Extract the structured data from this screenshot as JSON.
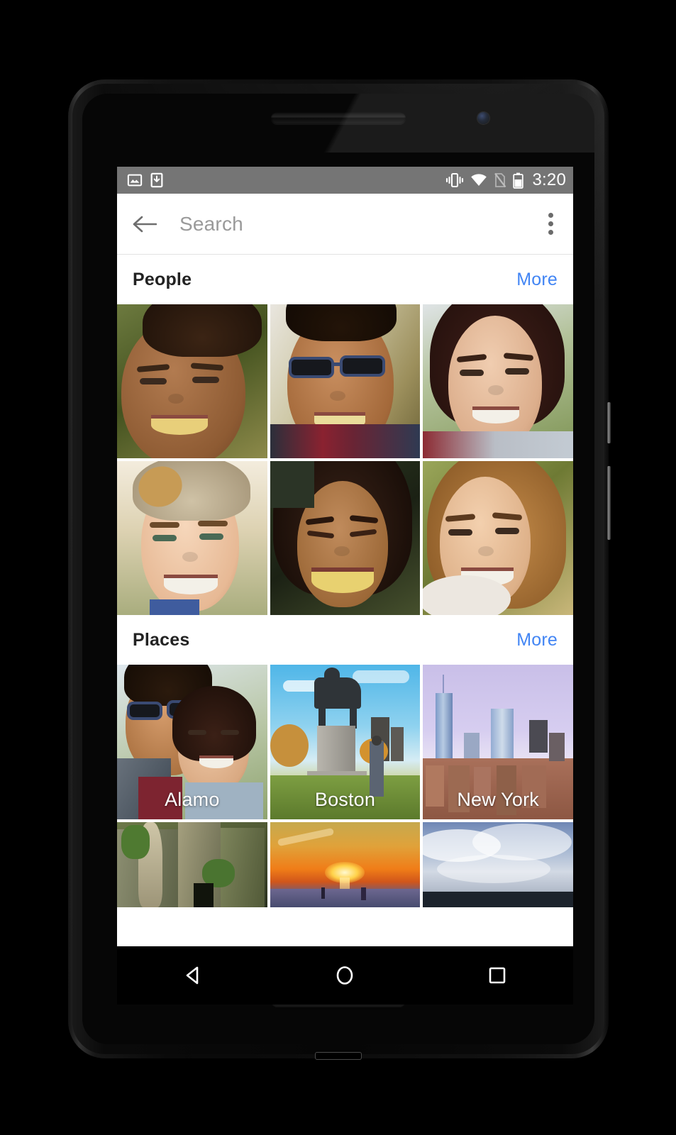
{
  "status_bar": {
    "left_icons": [
      "photo-icon",
      "download-icon"
    ],
    "right_icons": [
      "vibrate-icon",
      "wifi-icon",
      "no-sim-icon",
      "battery-icon"
    ],
    "time": "3:20",
    "battery_level": "60",
    "background_color": "#757575"
  },
  "toolbar": {
    "back_icon": "back-arrow-icon",
    "search_placeholder": "Search",
    "search_value": "",
    "overflow_icon": "overflow-menu-icon"
  },
  "sections": [
    {
      "id": "people",
      "title": "People",
      "more_label": "More",
      "more_color": "#4285F4",
      "tiles": [
        {
          "label": "",
          "alt": "smiling-man-curly-hair"
        },
        {
          "label": "",
          "alt": "man-with-sunglasses"
        },
        {
          "label": "",
          "alt": "smiling-woman-dark-hair"
        },
        {
          "label": "",
          "alt": "man-with-beanie"
        },
        {
          "label": "",
          "alt": "laughing-woman"
        },
        {
          "label": "",
          "alt": "woman-with-blonde-hair"
        }
      ]
    },
    {
      "id": "places",
      "title": "Places",
      "more_label": "More",
      "more_color": "#4285F4",
      "tiles": [
        {
          "label": "Alamo",
          "alt": "couple-selfie-outdoors"
        },
        {
          "label": "Boston",
          "alt": "equestrian-statue-in-park"
        },
        {
          "label": "New York",
          "alt": "manhattan-skyline"
        },
        {
          "label": "",
          "alt": "overgrown-temple-ruins"
        },
        {
          "label": "",
          "alt": "beach-sunset"
        },
        {
          "label": "",
          "alt": "cloudy-sky"
        }
      ]
    }
  ],
  "nav_bar": {
    "back_label": "back-button",
    "home_label": "home-button",
    "recents_label": "recents-button"
  }
}
